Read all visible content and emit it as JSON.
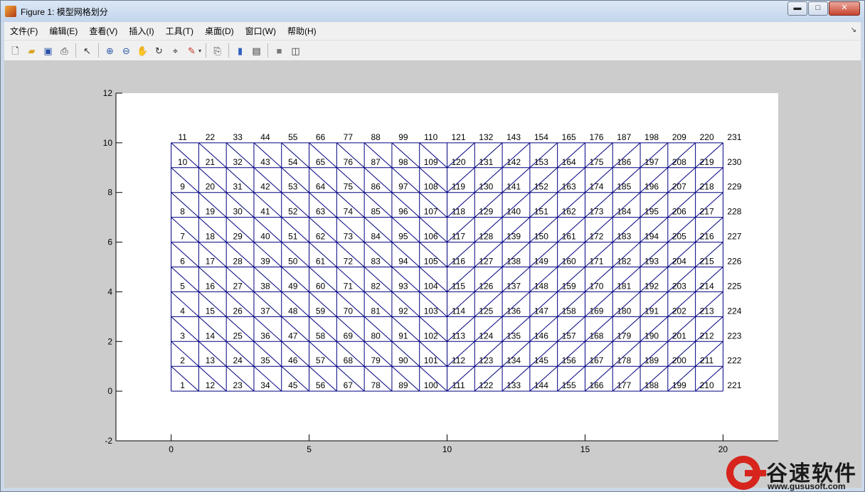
{
  "window": {
    "title": "Figure 1: 模型网格划分",
    "minimize_label": "▬",
    "maximize_label": "□",
    "close_label": "✕"
  },
  "menu": [
    {
      "label": "文件(F)"
    },
    {
      "label": "编辑(E)"
    },
    {
      "label": "查看(V)"
    },
    {
      "label": "插入(I)"
    },
    {
      "label": "工具(T)"
    },
    {
      "label": "桌面(D)"
    },
    {
      "label": "窗口(W)"
    },
    {
      "label": "帮助(H)"
    }
  ],
  "toolbar_icons": [
    "new-figure",
    "open-file",
    "save",
    "print",
    "|",
    "edit-plot-arrow",
    "|",
    "zoom-in",
    "zoom-out",
    "pan",
    "rotate-3d",
    "data-cursor",
    "brush",
    "brush-dropdown",
    "|",
    "link-plot",
    "|",
    "insert-colorbar",
    "insert-legend",
    "|",
    "hide-plot-tools",
    "show-plot-tools"
  ],
  "colors": {
    "mesh_line": "#000080",
    "axes_bg": "#ffffff",
    "figure_bg": "#cccccc",
    "watermark_red": "#d7241c"
  },
  "watermark": {
    "text": "谷速软件",
    "url": "www.gususoft.com"
  },
  "chart_data": {
    "type": "mesh",
    "title": "",
    "xlabel": "",
    "ylabel": "",
    "xlim": [
      -2,
      22
    ],
    "ylim": [
      -2,
      12
    ],
    "xticks": [
      0,
      5,
      10,
      15,
      20
    ],
    "yticks": [
      -2,
      0,
      2,
      4,
      6,
      8,
      10,
      12
    ],
    "grid": false,
    "mesh": {
      "x_nodes": [
        0,
        1,
        2,
        3,
        4,
        5,
        6,
        7,
        8,
        9,
        10,
        11,
        12,
        13,
        14,
        15,
        16,
        17,
        18,
        19,
        20
      ],
      "y_nodes": [
        0,
        1,
        2,
        3,
        4,
        5,
        6,
        7,
        8,
        9,
        10
      ],
      "diagonal_left_half": "top-left to bottom-right",
      "diagonal_right_half": "bottom-left to top-right",
      "symmetry_x": 10
    },
    "node_labels": [
      [
        1,
        12,
        23,
        34,
        45,
        56,
        67,
        78,
        89,
        100,
        111,
        122,
        133,
        144,
        155,
        166,
        177,
        188,
        199,
        210,
        221
      ],
      [
        2,
        13,
        24,
        35,
        46,
        57,
        68,
        79,
        90,
        101,
        112,
        123,
        134,
        145,
        156,
        167,
        178,
        189,
        200,
        211,
        222
      ],
      [
        3,
        14,
        25,
        36,
        47,
        58,
        69,
        80,
        91,
        102,
        113,
        124,
        135,
        146,
        157,
        168,
        179,
        190,
        201,
        212,
        223
      ],
      [
        4,
        15,
        26,
        37,
        48,
        59,
        70,
        81,
        92,
        103,
        114,
        125,
        136,
        147,
        158,
        169,
        180,
        191,
        202,
        213,
        224
      ],
      [
        5,
        16,
        27,
        38,
        49,
        60,
        71,
        82,
        93,
        104,
        115,
        126,
        137,
        148,
        159,
        170,
        181,
        192,
        203,
        214,
        225
      ],
      [
        6,
        17,
        28,
        39,
        50,
        61,
        72,
        83,
        94,
        105,
        116,
        127,
        138,
        149,
        160,
        171,
        182,
        193,
        204,
        215,
        226
      ],
      [
        7,
        18,
        29,
        40,
        51,
        62,
        73,
        84,
        95,
        106,
        117,
        128,
        139,
        150,
        161,
        172,
        183,
        194,
        205,
        216,
        227
      ],
      [
        8,
        19,
        30,
        41,
        52,
        63,
        74,
        85,
        96,
        107,
        118,
        129,
        140,
        151,
        162,
        173,
        184,
        195,
        206,
        217,
        228
      ],
      [
        9,
        20,
        31,
        42,
        53,
        64,
        75,
        86,
        97,
        108,
        119,
        130,
        141,
        152,
        163,
        174,
        185,
        196,
        207,
        218,
        229
      ],
      [
        10,
        21,
        32,
        43,
        54,
        65,
        76,
        87,
        98,
        109,
        120,
        131,
        142,
        153,
        164,
        175,
        186,
        197,
        208,
        219,
        230
      ],
      [
        11,
        22,
        33,
        44,
        55,
        66,
        77,
        88,
        99,
        110,
        121,
        132,
        143,
        154,
        165,
        176,
        187,
        198,
        209,
        220,
        231
      ]
    ]
  }
}
